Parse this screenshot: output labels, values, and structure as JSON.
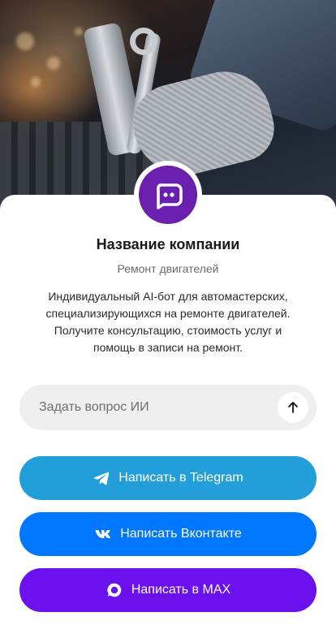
{
  "colors": {
    "avatar_bg": "#6b1fae",
    "telegram": "#229ed9",
    "vk": "#0077ff",
    "max": "#6a11ee"
  },
  "hero": {
    "icon": "mechanic-workshop-photo"
  },
  "avatar": {
    "icon": "chat-bot-icon"
  },
  "company": {
    "name": "Название компании",
    "subtitle": "Ремонт двигателей"
  },
  "description": {
    "lines": [
      "Индивидуальный AI-бот для автомастерских,",
      "специализирующихся на ремонте двигателей.",
      "Получите консультацию, стоимость услуг и",
      "помощь в записи на ремонт."
    ]
  },
  "ask": {
    "placeholder": "Задать вопрос ИИ",
    "value": "",
    "send_icon": "arrow-up-icon"
  },
  "buttons": {
    "telegram": {
      "label": "Написать в Telegram",
      "icon": "telegram-icon"
    },
    "vk": {
      "label": "Написать Вконтакте",
      "icon": "vk-icon"
    },
    "max": {
      "label": "Написать в MAX",
      "icon": "max-icon"
    }
  }
}
